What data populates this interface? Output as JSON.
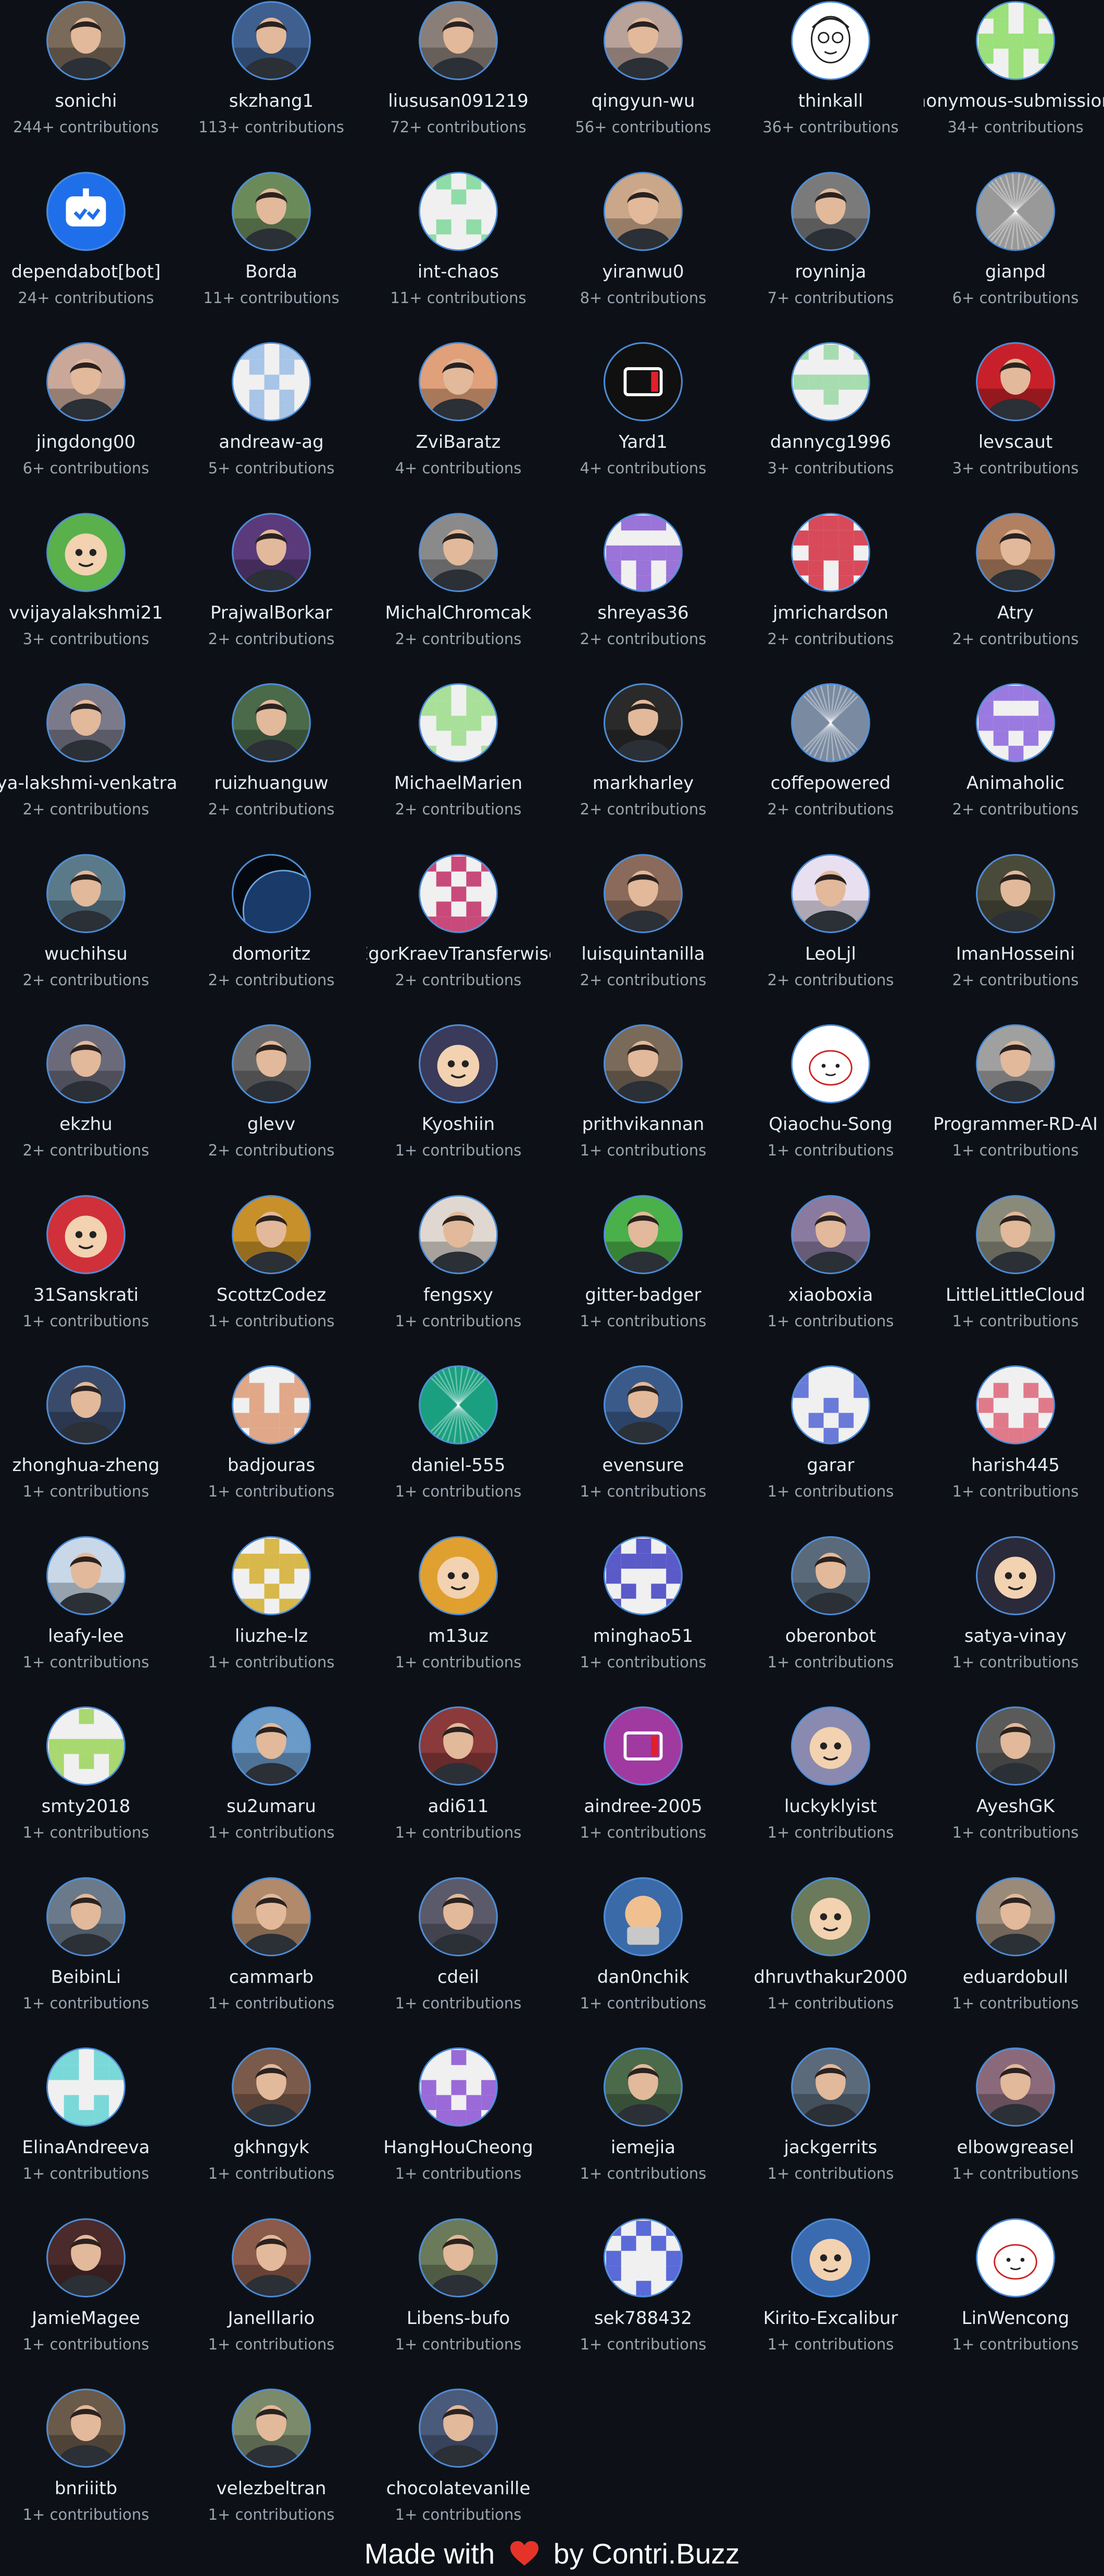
{
  "contributors": [
    {
      "name": "sonichi",
      "contributions": "244+ contributions",
      "avatar": "photo",
      "color": "#7a6a5a"
    },
    {
      "name": "skzhang1",
      "contributions": "113+ contributions",
      "avatar": "photo",
      "color": "#3f5f8f"
    },
    {
      "name": "liususan091219",
      "contributions": "72+ contributions",
      "avatar": "photo",
      "color": "#8a7f78"
    },
    {
      "name": "qingyun-wu",
      "contributions": "56+ contributions",
      "avatar": "photo",
      "color": "#b8a29a"
    },
    {
      "name": "thinkall",
      "contributions": "36+ contributions",
      "avatar": "sketch",
      "color": "#ffffff"
    },
    {
      "name": "Anonymous-submission-repo",
      "contributions": "34+ contributions",
      "avatar": "identicon",
      "color": "#9be07a"
    },
    {
      "name": "dependabot[bot]",
      "contributions": "24+ contributions",
      "avatar": "bot",
      "color": "#1f6feb"
    },
    {
      "name": "Borda",
      "contributions": "11+ contributions",
      "avatar": "photo",
      "color": "#6b8a5a"
    },
    {
      "name": "int-chaos",
      "contributions": "11+ contributions",
      "avatar": "identicon",
      "color": "#8fdca8"
    },
    {
      "name": "yiranwu0",
      "contributions": "8+ contributions",
      "avatar": "photo",
      "color": "#caa788"
    },
    {
      "name": "royninja",
      "contributions": "7+ contributions",
      "avatar": "photo",
      "color": "#7a7a7a"
    },
    {
      "name": "gianpd",
      "contributions": "6+ contributions",
      "avatar": "pattern",
      "color": "#999999"
    },
    {
      "name": "jingdong00",
      "contributions": "6+ contributions",
      "avatar": "photo",
      "color": "#c9a89a"
    },
    {
      "name": "andreaw-ag",
      "contributions": "5+ contributions",
      "avatar": "identicon",
      "color": "#a8c4e6"
    },
    {
      "name": "ZviBaratz",
      "contributions": "4+ contributions",
      "avatar": "photo",
      "color": "#e0a07a"
    },
    {
      "name": "Yard1",
      "contributions": "4+ contributions",
      "avatar": "logo",
      "color": "#101010"
    },
    {
      "name": "dannycg1996",
      "contributions": "3+ contributions",
      "avatar": "identicon",
      "color": "#a7dcb0"
    },
    {
      "name": "levscaut",
      "contributions": "3+ contributions",
      "avatar": "photo",
      "color": "#c8202a"
    },
    {
      "name": "vvijayalakshmi21",
      "contributions": "3+ contributions",
      "avatar": "cartoon",
      "color": "#5ab04a"
    },
    {
      "name": "PrajwalBorkar",
      "contributions": "2+ contributions",
      "avatar": "photo",
      "color": "#5a3a7a"
    },
    {
      "name": "MichalChromcak",
      "contributions": "2+ contributions",
      "avatar": "photo",
      "color": "#8a8a8a"
    },
    {
      "name": "shreyas36",
      "contributions": "2+ contributions",
      "avatar": "identicon",
      "color": "#9a74d8"
    },
    {
      "name": "jmrichardson",
      "contributions": "2+ contributions",
      "avatar": "identicon",
      "color": "#d84a5a"
    },
    {
      "name": "Atry",
      "contributions": "2+ contributions",
      "avatar": "photo",
      "color": "#b08060"
    },
    {
      "name": "priya-lakshmi-venkatraman",
      "contributions": "2+ contributions",
      "avatar": "photo",
      "color": "#7a7a8a"
    },
    {
      "name": "ruizhuanguw",
      "contributions": "2+ contributions",
      "avatar": "photo",
      "color": "#4a6a4a"
    },
    {
      "name": "MichaelMarien",
      "contributions": "2+ contributions",
      "avatar": "identicon",
      "color": "#a8e09a"
    },
    {
      "name": "markharley",
      "contributions": "2+ contributions",
      "avatar": "photo",
      "color": "#2a2a2a"
    },
    {
      "name": "coffepowered",
      "contributions": "2+ contributions",
      "avatar": "pattern",
      "color": "#7a8aa0"
    },
    {
      "name": "Animaholic",
      "contributions": "2+ contributions",
      "avatar": "identicon",
      "color": "#9a7ae0"
    },
    {
      "name": "wuchihsu",
      "contributions": "2+ contributions",
      "avatar": "photo",
      "color": "#5a7a8a"
    },
    {
      "name": "domoritz",
      "contributions": "2+ contributions",
      "avatar": "planet",
      "color": "#1a3a6a"
    },
    {
      "name": "EgorKraevTransferwise",
      "contributions": "2+ contributions",
      "avatar": "identicon",
      "color": "#c84a7a"
    },
    {
      "name": "luisquintanilla",
      "contributions": "2+ contributions",
      "avatar": "photo",
      "color": "#8a6a5a"
    },
    {
      "name": "LeoLjl",
      "contributions": "2+ contributions",
      "avatar": "photo",
      "color": "#e8e0f0"
    },
    {
      "name": "ImanHosseini",
      "contributions": "2+ contributions",
      "avatar": "photo",
      "color": "#4a4a3a"
    },
    {
      "name": "ekzhu",
      "contributions": "2+ contributions",
      "avatar": "photo",
      "color": "#6a6a7a"
    },
    {
      "name": "glevv",
      "contributions": "2+ contributions",
      "avatar": "photo",
      "color": "#6a6a6a"
    },
    {
      "name": "Kyoshiin",
      "contributions": "1+ contributions",
      "avatar": "cartoon",
      "color": "#3a3a5a"
    },
    {
      "name": "prithvikannan",
      "contributions": "1+ contributions",
      "avatar": "photo",
      "color": "#7a6a5a"
    },
    {
      "name": "Qiaochu-Song",
      "contributions": "1+ contributions",
      "avatar": "drawing",
      "color": "#ffffff"
    },
    {
      "name": "Programmer-RD-AI",
      "contributions": "1+ contributions",
      "avatar": "photo",
      "color": "#a0a0a0"
    },
    {
      "name": "31Sanskrati",
      "contributions": "1+ contributions",
      "avatar": "cartoon",
      "color": "#d0303a"
    },
    {
      "name": "ScottzCodez",
      "contributions": "1+ contributions",
      "avatar": "photo",
      "color": "#c8902a"
    },
    {
      "name": "fengsxy",
      "contributions": "1+ contributions",
      "avatar": "photo",
      "color": "#e0d8d0"
    },
    {
      "name": "gitter-badger",
      "contributions": "1+ contributions",
      "avatar": "photo",
      "color": "#4ab04a"
    },
    {
      "name": "xiaoboxia",
      "contributions": "1+ contributions",
      "avatar": "photo",
      "color": "#8a7aa0"
    },
    {
      "name": "LittleLittleCloud",
      "contributions": "1+ contributions",
      "avatar": "photo",
      "color": "#8a8a7a"
    },
    {
      "name": "zhonghua-zheng",
      "contributions": "1+ contributions",
      "avatar": "photo",
      "color": "#3a4a6a"
    },
    {
      "name": "badjouras",
      "contributions": "1+ contributions",
      "avatar": "identicon",
      "color": "#e0a888"
    },
    {
      "name": "daniel-555",
      "contributions": "1+ contributions",
      "avatar": "pattern",
      "color": "#1aa080"
    },
    {
      "name": "evensure",
      "contributions": "1+ contributions",
      "avatar": "photo",
      "color": "#3a5a8a"
    },
    {
      "name": "garar",
      "contributions": "1+ contributions",
      "avatar": "identicon",
      "color": "#6a7ad8"
    },
    {
      "name": "harish445",
      "contributions": "1+ contributions",
      "avatar": "identicon",
      "color": "#e07a8a"
    },
    {
      "name": "leafy-lee",
      "contributions": "1+ contributions",
      "avatar": "photo",
      "color": "#c8d8e8"
    },
    {
      "name": "liuzhe-lz",
      "contributions": "1+ contributions",
      "avatar": "identicon",
      "color": "#d8b84a"
    },
    {
      "name": "m13uz",
      "contributions": "1+ contributions",
      "avatar": "cartoon",
      "color": "#e0a030"
    },
    {
      "name": "minghao51",
      "contributions": "1+ contributions",
      "avatar": "identicon",
      "color": "#5a5ac8"
    },
    {
      "name": "oberonbot",
      "contributions": "1+ contributions",
      "avatar": "photo",
      "color": "#5a6a7a"
    },
    {
      "name": "satya-vinay",
      "contributions": "1+ contributions",
      "avatar": "cartoon",
      "color": "#2a2a3a"
    },
    {
      "name": "smty2018",
      "contributions": "1+ contributions",
      "avatar": "identicon",
      "color": "#a8d870"
    },
    {
      "name": "su2umaru",
      "contributions": "1+ contributions",
      "avatar": "photo",
      "color": "#6a9ac8"
    },
    {
      "name": "adi611",
      "contributions": "1+ contributions",
      "avatar": "photo",
      "color": "#8a3a3a"
    },
    {
      "name": "aindree-2005",
      "contributions": "1+ contributions",
      "avatar": "logo",
      "color": "#a03aa0"
    },
    {
      "name": "luckyklyist",
      "contributions": "1+ contributions",
      "avatar": "cartoon",
      "color": "#8a8ab0"
    },
    {
      "name": "AyeshGK",
      "contributions": "1+ contributions",
      "avatar": "photo",
      "color": "#5a5a5a"
    },
    {
      "name": "BeibinLi",
      "contributions": "1+ contributions",
      "avatar": "photo",
      "color": "#6a7a8a"
    },
    {
      "name": "cammarb",
      "contributions": "1+ contributions",
      "avatar": "photo",
      "color": "#b08a6a"
    },
    {
      "name": "cdeil",
      "contributions": "1+ contributions",
      "avatar": "photo",
      "color": "#5a5a6a"
    },
    {
      "name": "dan0nchik",
      "contributions": "1+ contributions",
      "avatar": "emoji",
      "color": "#3a6aa8"
    },
    {
      "name": "dhruvthakur2000",
      "contributions": "1+ contributions",
      "avatar": "cartoon",
      "color": "#6a7a5a"
    },
    {
      "name": "eduardobull",
      "contributions": "1+ contributions",
      "avatar": "photo",
      "color": "#9a8a7a"
    },
    {
      "name": "ElinaAndreeva",
      "contributions": "1+ contributions",
      "avatar": "identicon",
      "color": "#7ad8d8"
    },
    {
      "name": "gkhngyk",
      "contributions": "1+ contributions",
      "avatar": "photo",
      "color": "#7a5a4a"
    },
    {
      "name": "HangHouCheong",
      "contributions": "1+ contributions",
      "avatar": "identicon",
      "color": "#9a6ad8"
    },
    {
      "name": "iemejia",
      "contributions": "1+ contributions",
      "avatar": "photo",
      "color": "#4a6a4a"
    },
    {
      "name": "jackgerrits",
      "contributions": "1+ contributions",
      "avatar": "photo",
      "color": "#5a6a7a"
    },
    {
      "name": "elbowgreasel",
      "contributions": "1+ contributions",
      "avatar": "photo",
      "color": "#8a6a7a"
    },
    {
      "name": "JamieMagee",
      "contributions": "1+ contributions",
      "avatar": "photo",
      "color": "#4a2a2a"
    },
    {
      "name": "Janelllario",
      "contributions": "1+ contributions",
      "avatar": "photo",
      "color": "#8a5a4a"
    },
    {
      "name": "Libens-bufo",
      "contributions": "1+ contributions",
      "avatar": "photo",
      "color": "#6a7a5a"
    },
    {
      "name": "sek788432",
      "contributions": "1+ contributions",
      "avatar": "identicon",
      "color": "#5a6ad8"
    },
    {
      "name": "Kirito-Excalibur",
      "contributions": "1+ contributions",
      "avatar": "cartoon",
      "color": "#3a6ab0"
    },
    {
      "name": "LinWencong",
      "contributions": "1+ contributions",
      "avatar": "drawing",
      "color": "#ffffff"
    },
    {
      "name": "bnriiitb",
      "contributions": "1+ contributions",
      "avatar": "photo",
      "color": "#6a5a4a"
    },
    {
      "name": "velezbeltran",
      "contributions": "1+ contributions",
      "avatar": "photo",
      "color": "#7a8a6a"
    },
    {
      "name": "chocolatevanille",
      "contributions": "1+ contributions",
      "avatar": "photo",
      "color": "#4a5a7a"
    }
  ],
  "footer": {
    "prefix": "Made with",
    "heart_icon": "heart-icon",
    "by": "by",
    "brand": "Contri.Buzz",
    "heart_color": "#e5332a"
  },
  "colors": {
    "background": "#0d1117",
    "avatar_ring": "#4a8bd8",
    "name_text": "#e6edf3",
    "count_text": "#9aa4af"
  }
}
